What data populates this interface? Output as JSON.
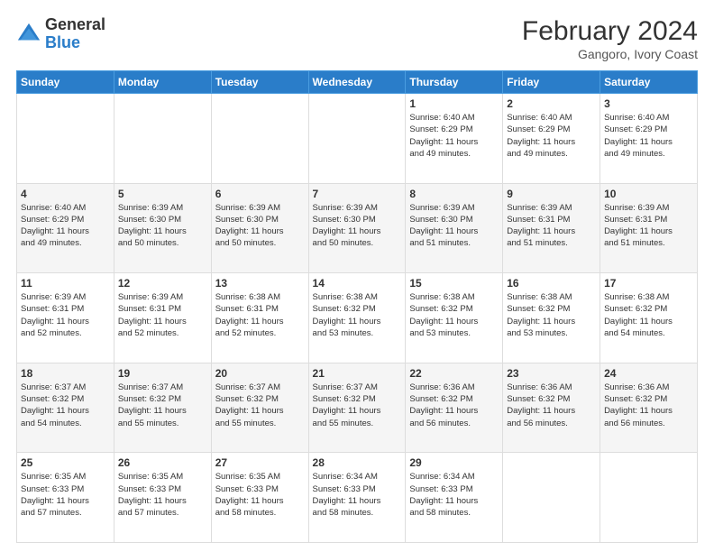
{
  "header": {
    "logo_general": "General",
    "logo_blue": "Blue",
    "month_year": "February 2024",
    "location": "Gangoro, Ivory Coast"
  },
  "days_of_week": [
    "Sunday",
    "Monday",
    "Tuesday",
    "Wednesday",
    "Thursday",
    "Friday",
    "Saturday"
  ],
  "weeks": [
    [
      {
        "day": "",
        "info": ""
      },
      {
        "day": "",
        "info": ""
      },
      {
        "day": "",
        "info": ""
      },
      {
        "day": "",
        "info": ""
      },
      {
        "day": "1",
        "info": "Sunrise: 6:40 AM\nSunset: 6:29 PM\nDaylight: 11 hours\nand 49 minutes."
      },
      {
        "day": "2",
        "info": "Sunrise: 6:40 AM\nSunset: 6:29 PM\nDaylight: 11 hours\nand 49 minutes."
      },
      {
        "day": "3",
        "info": "Sunrise: 6:40 AM\nSunset: 6:29 PM\nDaylight: 11 hours\nand 49 minutes."
      }
    ],
    [
      {
        "day": "4",
        "info": "Sunrise: 6:40 AM\nSunset: 6:29 PM\nDaylight: 11 hours\nand 49 minutes."
      },
      {
        "day": "5",
        "info": "Sunrise: 6:39 AM\nSunset: 6:30 PM\nDaylight: 11 hours\nand 50 minutes."
      },
      {
        "day": "6",
        "info": "Sunrise: 6:39 AM\nSunset: 6:30 PM\nDaylight: 11 hours\nand 50 minutes."
      },
      {
        "day": "7",
        "info": "Sunrise: 6:39 AM\nSunset: 6:30 PM\nDaylight: 11 hours\nand 50 minutes."
      },
      {
        "day": "8",
        "info": "Sunrise: 6:39 AM\nSunset: 6:30 PM\nDaylight: 11 hours\nand 51 minutes."
      },
      {
        "day": "9",
        "info": "Sunrise: 6:39 AM\nSunset: 6:31 PM\nDaylight: 11 hours\nand 51 minutes."
      },
      {
        "day": "10",
        "info": "Sunrise: 6:39 AM\nSunset: 6:31 PM\nDaylight: 11 hours\nand 51 minutes."
      }
    ],
    [
      {
        "day": "11",
        "info": "Sunrise: 6:39 AM\nSunset: 6:31 PM\nDaylight: 11 hours\nand 52 minutes."
      },
      {
        "day": "12",
        "info": "Sunrise: 6:39 AM\nSunset: 6:31 PM\nDaylight: 11 hours\nand 52 minutes."
      },
      {
        "day": "13",
        "info": "Sunrise: 6:38 AM\nSunset: 6:31 PM\nDaylight: 11 hours\nand 52 minutes."
      },
      {
        "day": "14",
        "info": "Sunrise: 6:38 AM\nSunset: 6:32 PM\nDaylight: 11 hours\nand 53 minutes."
      },
      {
        "day": "15",
        "info": "Sunrise: 6:38 AM\nSunset: 6:32 PM\nDaylight: 11 hours\nand 53 minutes."
      },
      {
        "day": "16",
        "info": "Sunrise: 6:38 AM\nSunset: 6:32 PM\nDaylight: 11 hours\nand 53 minutes."
      },
      {
        "day": "17",
        "info": "Sunrise: 6:38 AM\nSunset: 6:32 PM\nDaylight: 11 hours\nand 54 minutes."
      }
    ],
    [
      {
        "day": "18",
        "info": "Sunrise: 6:37 AM\nSunset: 6:32 PM\nDaylight: 11 hours\nand 54 minutes."
      },
      {
        "day": "19",
        "info": "Sunrise: 6:37 AM\nSunset: 6:32 PM\nDaylight: 11 hours\nand 55 minutes."
      },
      {
        "day": "20",
        "info": "Sunrise: 6:37 AM\nSunset: 6:32 PM\nDaylight: 11 hours\nand 55 minutes."
      },
      {
        "day": "21",
        "info": "Sunrise: 6:37 AM\nSunset: 6:32 PM\nDaylight: 11 hours\nand 55 minutes."
      },
      {
        "day": "22",
        "info": "Sunrise: 6:36 AM\nSunset: 6:32 PM\nDaylight: 11 hours\nand 56 minutes."
      },
      {
        "day": "23",
        "info": "Sunrise: 6:36 AM\nSunset: 6:32 PM\nDaylight: 11 hours\nand 56 minutes."
      },
      {
        "day": "24",
        "info": "Sunrise: 6:36 AM\nSunset: 6:32 PM\nDaylight: 11 hours\nand 56 minutes."
      }
    ],
    [
      {
        "day": "25",
        "info": "Sunrise: 6:35 AM\nSunset: 6:33 PM\nDaylight: 11 hours\nand 57 minutes."
      },
      {
        "day": "26",
        "info": "Sunrise: 6:35 AM\nSunset: 6:33 PM\nDaylight: 11 hours\nand 57 minutes."
      },
      {
        "day": "27",
        "info": "Sunrise: 6:35 AM\nSunset: 6:33 PM\nDaylight: 11 hours\nand 58 minutes."
      },
      {
        "day": "28",
        "info": "Sunrise: 6:34 AM\nSunset: 6:33 PM\nDaylight: 11 hours\nand 58 minutes."
      },
      {
        "day": "29",
        "info": "Sunrise: 6:34 AM\nSunset: 6:33 PM\nDaylight: 11 hours\nand 58 minutes."
      },
      {
        "day": "",
        "info": ""
      },
      {
        "day": "",
        "info": ""
      }
    ]
  ]
}
